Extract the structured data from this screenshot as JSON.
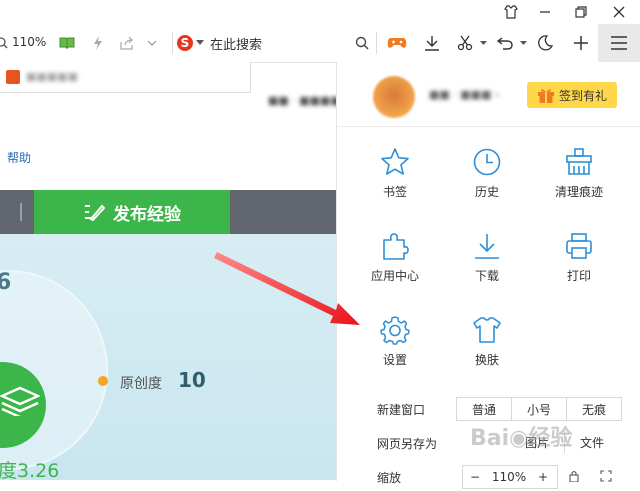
{
  "toolbar": {
    "zoom": "110%",
    "search_placeholder": "在此搜索"
  },
  "page": {
    "help_link": "帮助",
    "publish_button": "发布经验",
    "number_left": "6",
    "originality_label": "原创度",
    "originality_value": "10",
    "degree_text": "度3.26"
  },
  "menu": {
    "signin_button": "签到有礼",
    "grid": [
      {
        "label": "书签",
        "icon": "star-icon"
      },
      {
        "label": "历史",
        "icon": "clock-icon"
      },
      {
        "label": "清理痕迹",
        "icon": "broom-icon"
      },
      {
        "label": "应用中心",
        "icon": "puzzle-icon"
      },
      {
        "label": "下载",
        "icon": "download-icon"
      },
      {
        "label": "打印",
        "icon": "printer-icon"
      },
      {
        "label": "设置",
        "icon": "gear-icon"
      },
      {
        "label": "换肤",
        "icon": "shirt-icon"
      }
    ],
    "new_window": {
      "label": "新建窗口",
      "options": [
        "普通",
        "小号",
        "无痕"
      ]
    },
    "save_as": {
      "label": "网页另存为",
      "options": [
        "图片",
        "文件"
      ]
    },
    "zoom_row": {
      "label": "缩放",
      "minus": "−",
      "value": "110%",
      "plus": "+"
    }
  },
  "colors": {
    "accent_blue": "#2e8fd6",
    "publish_green": "#3cb64b",
    "signin_yellow": "#ffd84a",
    "arrow_red": "#e8141a"
  }
}
